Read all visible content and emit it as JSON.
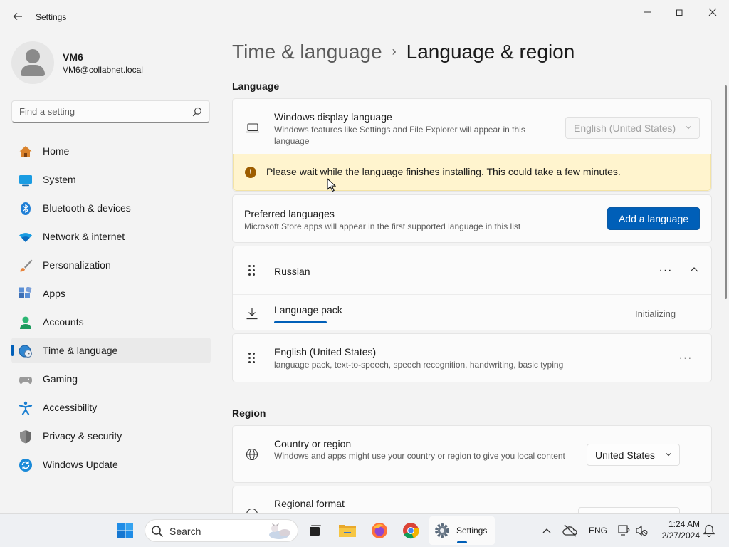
{
  "window": {
    "title": "Settings",
    "back_icon": "arrow-left-icon",
    "controls": [
      "minimize-icon",
      "maximize-icon",
      "close-icon"
    ]
  },
  "user": {
    "name": "VM6",
    "email": "VM6@collabnet.local"
  },
  "search": {
    "placeholder": "Find a setting"
  },
  "sidebar": {
    "items": [
      {
        "label": "Home",
        "icon": "home-icon",
        "active": false
      },
      {
        "label": "System",
        "icon": "system-icon",
        "active": false
      },
      {
        "label": "Bluetooth & devices",
        "icon": "bluetooth-icon",
        "active": false
      },
      {
        "label": "Network & internet",
        "icon": "network-icon",
        "active": false
      },
      {
        "label": "Personalization",
        "icon": "brush-icon",
        "active": false
      },
      {
        "label": "Apps",
        "icon": "apps-icon",
        "active": false
      },
      {
        "label": "Accounts",
        "icon": "accounts-icon",
        "active": false
      },
      {
        "label": "Time & language",
        "icon": "time-language-icon",
        "active": true
      },
      {
        "label": "Gaming",
        "icon": "gaming-icon",
        "active": false
      },
      {
        "label": "Accessibility",
        "icon": "accessibility-icon",
        "active": false
      },
      {
        "label": "Privacy & security",
        "icon": "shield-icon",
        "active": false
      },
      {
        "label": "Windows Update",
        "icon": "update-icon",
        "active": false
      }
    ]
  },
  "breadcrumb": {
    "parent": "Time & language",
    "separator": "›",
    "current": "Language & region"
  },
  "language": {
    "section_title": "Language",
    "display_language": {
      "title": "Windows display language",
      "subtitle": "Windows features like Settings and File Explorer will appear in this language",
      "value": "English (United States)",
      "icon": "laptop-icon"
    },
    "warning": {
      "text": "Please wait while the language finishes installing. This could take a few minutes."
    },
    "preferred": {
      "title": "Preferred languages",
      "subtitle": "Microsoft Store apps will appear in the first supported language in this list",
      "button": "Add a language"
    },
    "items": [
      {
        "name": "Russian",
        "more": "···",
        "sub_title": "Language pack",
        "sub_status": "Initializing",
        "progress": 0.15
      },
      {
        "name": "English (United States)",
        "detail": "language pack, text-to-speech, speech recognition, handwriting, basic typing",
        "more": "···"
      }
    ]
  },
  "region": {
    "section_title": "Region",
    "country": {
      "title": "Country or region",
      "subtitle": "Windows and apps might use your country or region to give you local content",
      "value": "United States",
      "icon": "globe-icon"
    },
    "format": {
      "title": "Regional format"
    }
  },
  "taskbar": {
    "search_label": "Search",
    "settings_label": "Settings",
    "lang": "ENG",
    "time": "1:24 AM",
    "date": "2/27/2024",
    "accent": "#005fb8"
  }
}
